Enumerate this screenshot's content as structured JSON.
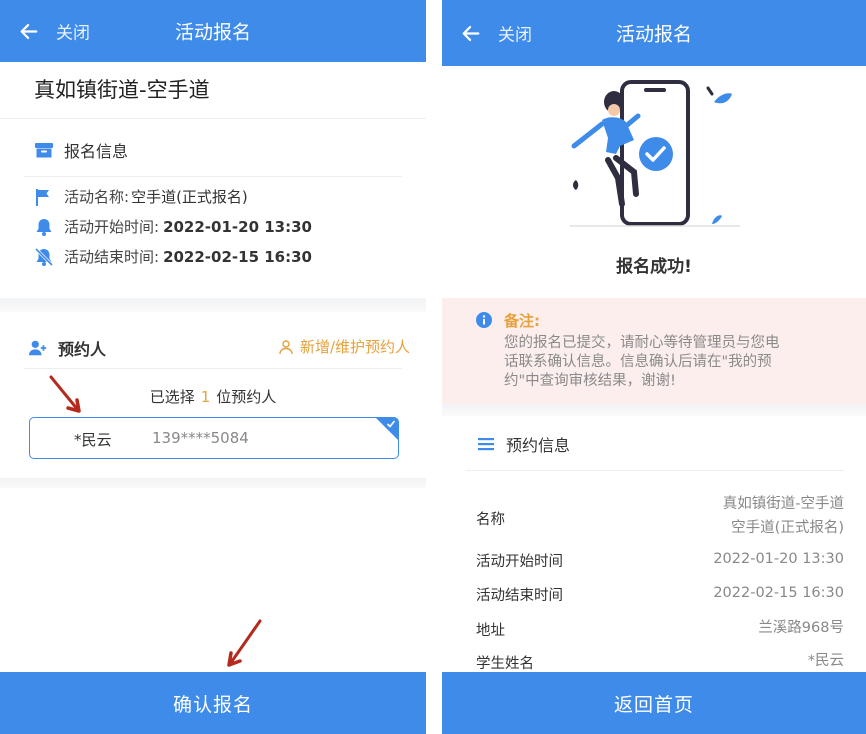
{
  "left": {
    "nav": {
      "title": "活动报名",
      "close_label": "关闭"
    },
    "org_title": "真如镇街道-空手道",
    "registration_info": {
      "heading": "报名信息",
      "rows": [
        {
          "label": "活动名称:",
          "value": "空手道(正式报名)"
        },
        {
          "label": "活动开始时间:",
          "value": "2022-01-20 13:30"
        },
        {
          "label": "活动结束时间:",
          "value": "2022-02-15 16:30"
        }
      ]
    },
    "reservation": {
      "heading": "预约人",
      "maintain_label": "新增/维护预约人",
      "selected_prefix": "已选择",
      "selected_count": "1",
      "selected_suffix": "位预约人",
      "person_name": "*民云",
      "person_phone": "139****5084"
    },
    "confirm_label": "确认报名"
  },
  "right": {
    "nav": {
      "title": "活动报名",
      "close_label": "关闭"
    },
    "success_text": "报名成功!",
    "note": {
      "label": "备注:",
      "lines": [
        "您的报名已提交，请耐心等待管理员与您电",
        "话联系确认信息。信息确认后请在\"我的预",
        "约\"中查询审核结果，谢谢!"
      ]
    },
    "booking_info": {
      "heading": "预约信息",
      "rows": [
        {
          "label": "名称",
          "lines": [
            "真如镇街道-空手道",
            "空手道(正式报名)"
          ]
        },
        {
          "label": "活动开始时间",
          "lines": [
            "2022-01-20 13:30"
          ]
        },
        {
          "label": "活动结束时间",
          "lines": [
            "2022-02-15 16:30"
          ]
        },
        {
          "label": "地址",
          "lines": [
            "兰溪路968号"
          ]
        },
        {
          "label": "学生姓名",
          "lines": [
            "*民云"
          ]
        }
      ]
    },
    "home_label": "返回首页"
  },
  "colors": {
    "primary": "#3f8bea",
    "accent_orange": "#e6a23c",
    "note_bg": "#fbeeed",
    "arrow_red": "#b52a1c"
  },
  "icons": {
    "back": "arrow-left-icon",
    "archive": "archive-box-icon",
    "flag": "flag-icon",
    "bell": "bell-icon",
    "bell_off": "bell-slash-icon",
    "add_user": "user-plus-icon",
    "user_outline": "user-outline-icon",
    "check": "check-icon",
    "info": "info-circle-icon",
    "list": "list-icon"
  }
}
